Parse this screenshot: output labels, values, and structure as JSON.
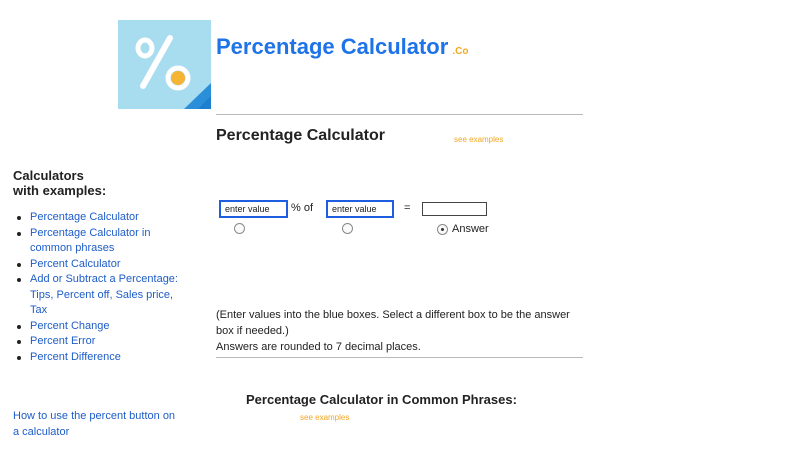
{
  "site": {
    "title": "Percentage Calculator",
    "tld": ".Co"
  },
  "main": {
    "title": "Percentage Calculator",
    "see_examples": "see examples",
    "instructions_line1": "(Enter values into the blue boxes. Select a different box to be the answer box if needed.)",
    "instructions_line2": "Answers are rounded to 7 decimal places."
  },
  "calculator": {
    "input1_placeholder": "enter value",
    "op1": "% of",
    "input2_placeholder": "enter value",
    "equals": "=",
    "answer_label": "Answer",
    "selected_radio": 3
  },
  "sidebar": {
    "heading_line1": "Calculators",
    "heading_line2": "with examples:",
    "items": [
      {
        "label": "Percentage Calculator"
      },
      {
        "label": "Percentage Calculator in common phrases"
      },
      {
        "label": "Percent Calculator"
      },
      {
        "label": "Add or Subtract a Percentage: Tips, Percent off, Sales price, Tax"
      },
      {
        "label": "Percent Change"
      },
      {
        "label": "Percent Error"
      },
      {
        "label": "Percent Difference"
      }
    ],
    "howto": "How to use the percent button on a calculator"
  },
  "phrases": {
    "title": "Percentage Calculator in Common Phrases:",
    "see_examples": "see examples"
  },
  "colors": {
    "link": "#1e5dc7",
    "title_blue": "#1e73e8",
    "accent_orange": "#f5a623",
    "logo_bg": "#a8dcef"
  }
}
